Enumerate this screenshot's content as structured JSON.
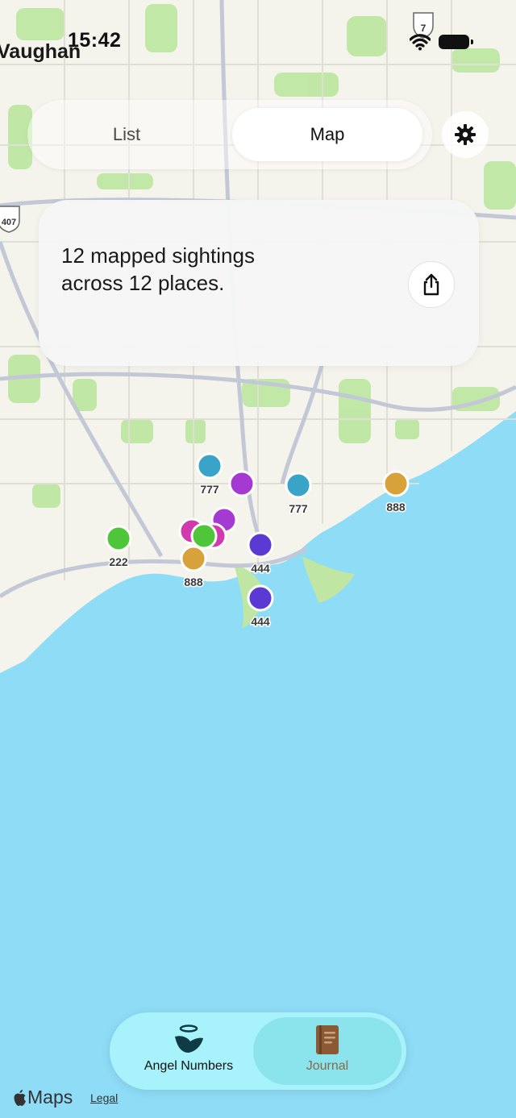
{
  "status_bar": {
    "time": "15:42"
  },
  "map": {
    "city_label": "Vaughan",
    "shield_407": "407",
    "shield_7": "7",
    "pins": [
      {
        "label": "777",
        "color": "#3aa4c8"
      },
      {
        "label": "",
        "color": "#a53ad2"
      },
      {
        "label": "777",
        "color": "#3aa4c8"
      },
      {
        "label": "888",
        "color": "#d8a23a"
      },
      {
        "label": "",
        "color": "#d13aaf"
      },
      {
        "label": "",
        "color": "#a53ad2"
      },
      {
        "label": "",
        "color": "#d13aaf"
      },
      {
        "label": "",
        "color": "#4fc63a"
      },
      {
        "label": "222",
        "color": "#4fc63a"
      },
      {
        "label": "888",
        "color": "#d8a23a"
      },
      {
        "label": "444",
        "color": "#5a3ad2"
      },
      {
        "label": "444",
        "color": "#5a3ad2"
      }
    ]
  },
  "segmented": {
    "list_label": "List",
    "map_label": "Map",
    "selected": "Map"
  },
  "settings_icon": "gear-icon",
  "summary": {
    "text": "12 mapped sightings across 12 places.",
    "share_icon": "share-icon"
  },
  "tabbar": {
    "tabs": [
      {
        "label": "Angel Numbers",
        "icon": "angel-wing-icon"
      },
      {
        "label": "Journal",
        "icon": "journal-book-icon",
        "selected": true
      }
    ]
  },
  "footer": {
    "maps_brand": "Maps",
    "legal": "Legal"
  },
  "colors": {
    "water": "#8fdcf6",
    "land": "#f4f3ec",
    "park": "#bfe7a3",
    "tabbar": "#a7f2fb",
    "journal_label": "#8a6a4a"
  }
}
